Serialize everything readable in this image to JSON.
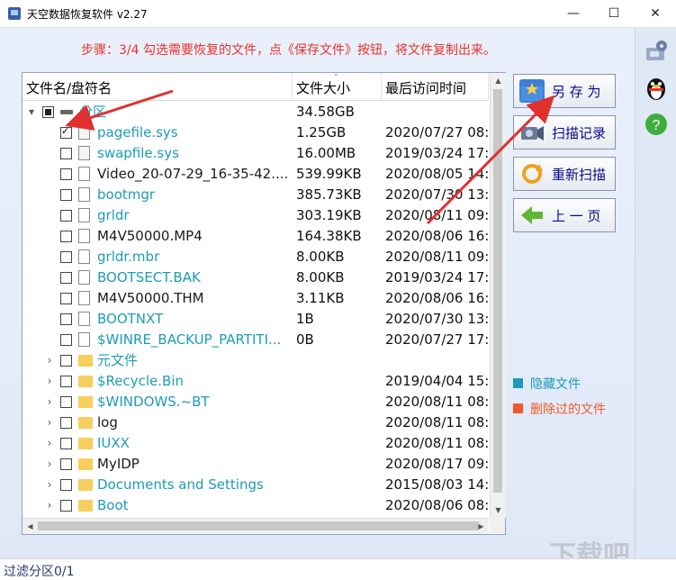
{
  "window": {
    "title": "天空数据恢复软件 v2.27",
    "min": "—",
    "max": "☐",
    "close": "✕"
  },
  "step_text": "步骤：3/4 勾选需要恢复的文件，点《保存文件》按钮，将文件复制出来。",
  "list": {
    "columns": [
      "文件名/盘符名",
      "文件大小",
      "最后访问时间"
    ],
    "rows": [
      {
        "name": "分区",
        "size": "34.58GB",
        "date": "",
        "type": "drive",
        "color": "cyan",
        "check": "partial",
        "expander": "▾",
        "indent": 0
      },
      {
        "name": "pagefile.sys",
        "size": "1.25GB",
        "date": "2020/07/27 08:3",
        "type": "sys",
        "color": "cyan",
        "check": "checked",
        "expander": "",
        "indent": 1
      },
      {
        "name": "swapfile.sys",
        "size": "16.00MB",
        "date": "2019/03/24 17:",
        "type": "sys",
        "color": "cyan",
        "check": "none",
        "expander": "",
        "indent": 1
      },
      {
        "name": "Video_20-07-29_16-35-42....",
        "size": "539.99KB",
        "date": "2020/08/05 14:",
        "type": "file",
        "color": "black",
        "check": "none",
        "expander": "",
        "indent": 1
      },
      {
        "name": "bootmgr",
        "size": "385.73KB",
        "date": "2020/07/30 13:",
        "type": "file",
        "color": "cyan",
        "check": "none",
        "expander": "",
        "indent": 1
      },
      {
        "name": "grldr",
        "size": "303.19KB",
        "date": "2020/08/11 09:",
        "type": "file",
        "color": "cyan",
        "check": "none",
        "expander": "",
        "indent": 1
      },
      {
        "name": "M4V50000.MP4",
        "size": "164.38KB",
        "date": "2020/08/06 16:",
        "type": "file",
        "color": "black",
        "check": "none",
        "expander": "",
        "indent": 1
      },
      {
        "name": "grldr.mbr",
        "size": "8.00KB",
        "date": "2020/08/11 09:",
        "type": "file",
        "color": "cyan",
        "check": "none",
        "expander": "",
        "indent": 1
      },
      {
        "name": "BOOTSECT.BAK",
        "size": "8.00KB",
        "date": "2019/03/24 17:",
        "type": "file",
        "color": "cyan",
        "check": "none",
        "expander": "",
        "indent": 1
      },
      {
        "name": "M4V50000.THM",
        "size": "3.11KB",
        "date": "2020/08/06 16:",
        "type": "file",
        "color": "black",
        "check": "none",
        "expander": "",
        "indent": 1
      },
      {
        "name": "BOOTNXT",
        "size": "1B",
        "date": "2020/07/30 13:",
        "type": "file",
        "color": "cyan",
        "check": "none",
        "expander": "",
        "indent": 1
      },
      {
        "name": "$WINRE_BACKUP_PARTITI...",
        "size": "0B",
        "date": "2020/07/27 17:5",
        "type": "file",
        "color": "cyan",
        "check": "none",
        "expander": "",
        "indent": 1
      },
      {
        "name": "元文件",
        "size": "",
        "date": "",
        "type": "folder",
        "color": "cyan",
        "check": "none",
        "expander": "›",
        "indent": 1
      },
      {
        "name": "$Recycle.Bin",
        "size": "",
        "date": "2019/04/04 15:",
        "type": "folder",
        "color": "cyan",
        "check": "none",
        "expander": "›",
        "indent": 1
      },
      {
        "name": "$WINDOWS.~BT",
        "size": "",
        "date": "2020/08/11 08:",
        "type": "folder",
        "color": "cyan",
        "check": "none",
        "expander": "›",
        "indent": 1
      },
      {
        "name": "log",
        "size": "",
        "date": "2020/08/11 08:",
        "type": "folder",
        "color": "black",
        "check": "none",
        "expander": "›",
        "indent": 1
      },
      {
        "name": "IUXX",
        "size": "",
        "date": "2020/08/11 08:",
        "type": "folder",
        "color": "cyan",
        "check": "none",
        "expander": "›",
        "indent": 1
      },
      {
        "name": "MyIDP",
        "size": "",
        "date": "2020/08/17 09:",
        "type": "folder",
        "color": "black",
        "check": "none",
        "expander": "›",
        "indent": 1
      },
      {
        "name": "Documents and Settings",
        "size": "",
        "date": "2015/08/03 14:",
        "type": "folder",
        "color": "cyan",
        "check": "none",
        "expander": "›",
        "indent": 1
      },
      {
        "name": "Boot",
        "size": "",
        "date": "2020/08/06 08:",
        "type": "folder",
        "color": "cyan",
        "check": "none",
        "expander": "›",
        "indent": 1
      }
    ]
  },
  "buttons": {
    "save_as": "另 存 为",
    "scan_record": "扫描记录",
    "rescan": "重新扫描",
    "prev_page": "上 一 页"
  },
  "legend": {
    "hidden": "隐藏文件",
    "deleted": "删除过的文件"
  },
  "colors": {
    "cyan": "#1e9bb8",
    "black": "#1a1a1a",
    "hidden": "#1e9bb8",
    "deleted": "#f05a28",
    "arrow": "#e03030"
  },
  "status": "过滤分区0/1",
  "watermark": "下载吧",
  "icons": {
    "side": [
      "settings-icon",
      "qq-penguin-icon",
      "help-icon"
    ]
  }
}
